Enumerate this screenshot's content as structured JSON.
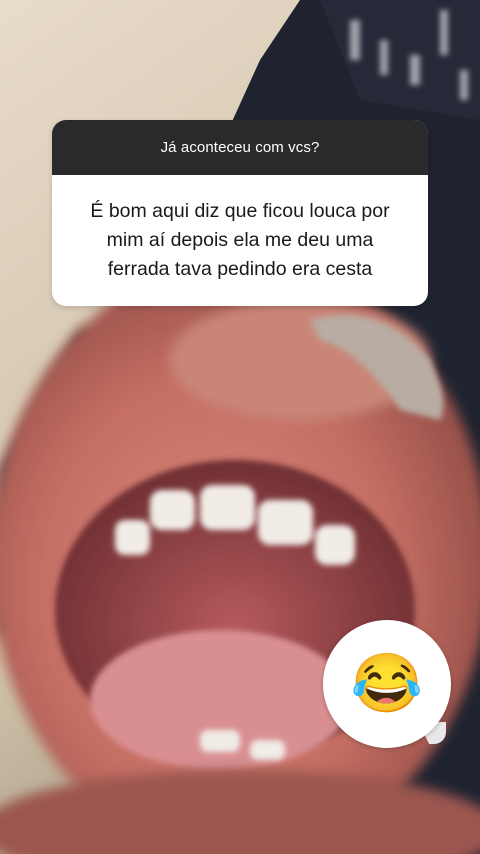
{
  "question": {
    "header": "Já aconteceu com vcs?",
    "answer": "É bom aqui diz que ficou louca por mim aí depois ela me deu uma ferrada tava pedindo era cesta"
  },
  "reaction": {
    "emoji": "😂",
    "icon": "face-with-tears-of-joy-icon"
  }
}
